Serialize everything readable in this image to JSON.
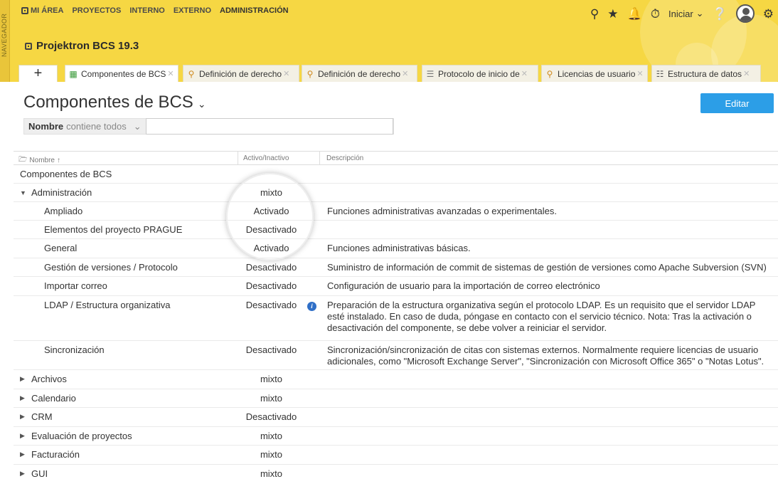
{
  "nav": {
    "side_label": "NAVEGADOR",
    "items": [
      {
        "label": "MI ÁREA",
        "icon": "home-icon"
      },
      {
        "label": "PROYECTOS"
      },
      {
        "label": "INTERNO"
      },
      {
        "label": "EXTERNO"
      },
      {
        "label": "ADMINISTRACIÓN",
        "active": true
      }
    ],
    "user_menu_label": "Iniciar"
  },
  "app": {
    "title": "Projektron BCS 19.3"
  },
  "tabs": [
    {
      "label": "Componentes de BCS",
      "icon": "component-icon",
      "active": true
    },
    {
      "label": "Definición de derecho",
      "icon": "key-icon"
    },
    {
      "label": "Definición de derecho",
      "icon": "key-icon"
    },
    {
      "label": "Protocolo de inicio de",
      "icon": "list-icon"
    },
    {
      "label": "Licencias de usuario",
      "icon": "key-icon"
    },
    {
      "label": "Estructura de datos",
      "icon": "tree-icon"
    }
  ],
  "page": {
    "title": "Componentes de BCS",
    "edit_button": "Editar"
  },
  "filter": {
    "label": "Nombre",
    "operator": "contiene todos",
    "value": ""
  },
  "table": {
    "headers": {
      "name": "Nombre",
      "active": "Activo/Inactivo",
      "desc": "Descripción"
    },
    "rows": [
      {
        "name": "Componentes de BCS",
        "level": 0,
        "state": "",
        "desc": ""
      },
      {
        "name": "Administración",
        "level": 0,
        "expander": "expanded",
        "state": "mixto",
        "desc": ""
      },
      {
        "name": "Ampliado",
        "level": 1,
        "state": "Activado",
        "desc": "Funciones administrativas avanzadas o experimentales."
      },
      {
        "name": "Elementos del proyecto PRAGUE",
        "level": 1,
        "state": "Desactivado",
        "desc": ""
      },
      {
        "name": "General",
        "level": 1,
        "state": "Activado",
        "desc": "Funciones administrativas básicas."
      },
      {
        "name": "Gestión de versiones / Protocolo",
        "level": 1,
        "state": "Desactivado",
        "desc": "Suministro de información de commit de sistemas de gestión de versiones como Apache Subversion (SVN)"
      },
      {
        "name": "Importar correo",
        "level": 1,
        "state": "Desactivado",
        "desc": "Configuración de usuario para la importación de correo electrónico"
      },
      {
        "name": "LDAP / Estructura organizativa",
        "level": 1,
        "state": "Desactivado",
        "info": true,
        "desc": "Preparación de la estructura organizativa según el protocolo LDAP. Es un requisito que el servidor LDAP esté instalado. En caso de duda, póngase en contacto con el servicio técnico. Nota: Tras la activación o desactivación del componente, se debe volver a reiniciar el servidor."
      },
      {
        "name": "Sincronización",
        "level": 1,
        "state": "Desactivado",
        "desc": "Sincronización/sincronización de citas con sistemas externos. Normalmente requiere licencias de usuario adicionales, como \"Microsoft Exchange Server\", \"Sincronización con Microsoft Office 365\" o \"Notas Lotus\"."
      },
      {
        "name": "Archivos",
        "level": 0,
        "expander": "collapsed",
        "state": "mixto",
        "desc": ""
      },
      {
        "name": "Calendario",
        "level": 0,
        "expander": "collapsed",
        "state": "mixto",
        "desc": ""
      },
      {
        "name": "CRM",
        "level": 0,
        "expander": "collapsed",
        "state": "Desactivado",
        "desc": ""
      },
      {
        "name": "Evaluación de proyectos",
        "level": 0,
        "expander": "collapsed",
        "state": "mixto",
        "desc": ""
      },
      {
        "name": "Facturación",
        "level": 0,
        "expander": "collapsed",
        "state": "mixto",
        "desc": ""
      },
      {
        "name": "GUI",
        "level": 0,
        "expander": "collapsed",
        "state": "mixto",
        "desc": ""
      }
    ]
  },
  "colors": {
    "header": "#f6d743",
    "accent": "#2c9ee7"
  }
}
